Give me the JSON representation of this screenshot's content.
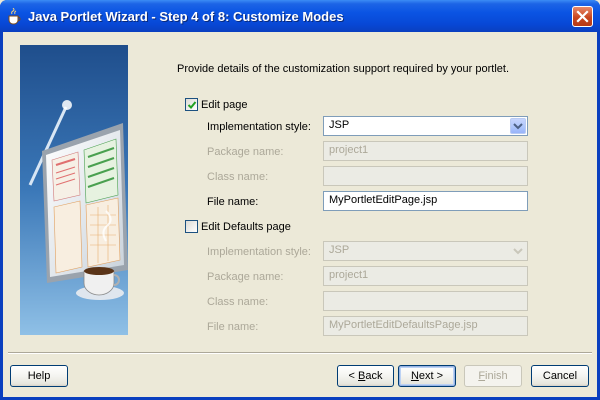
{
  "window": {
    "title": "Java Portlet Wizard - Step 4 of 8: Customize Modes"
  },
  "intro_text": "Provide details of the customization support required by your portlet.",
  "edit_page": {
    "label": "Edit page",
    "checked": true,
    "impl_style_label": "Implementation style:",
    "impl_style_value": "JSP",
    "package_label": "Package name:",
    "package_value": "project1",
    "class_label": "Class name:",
    "class_value": "",
    "file_label": "File name:",
    "file_value": "MyPortletEditPage.jsp"
  },
  "edit_defaults_page": {
    "label": "Edit Defaults page",
    "checked": false,
    "impl_style_label": "Implementation style:",
    "impl_style_value": "JSP",
    "package_label": "Package name:",
    "package_value": "project1",
    "class_label": "Class name:",
    "class_value": "",
    "file_label": "File name:",
    "file_value": "MyPortletEditDefaultsPage.jsp"
  },
  "buttons": {
    "help": "Help",
    "back_prefix": "< ",
    "back_mnemonic": "B",
    "back_rest": "ack",
    "next_mnemonic": "N",
    "next_rest": "ext >",
    "finish_mnemonic": "F",
    "finish_rest": "inish",
    "cancel": "Cancel"
  },
  "colors": {
    "titlebar": "#0a54e3",
    "dialog_bg": "#ece9d8",
    "disabled_text": "#aca899",
    "field_border": "#7f9db9"
  }
}
